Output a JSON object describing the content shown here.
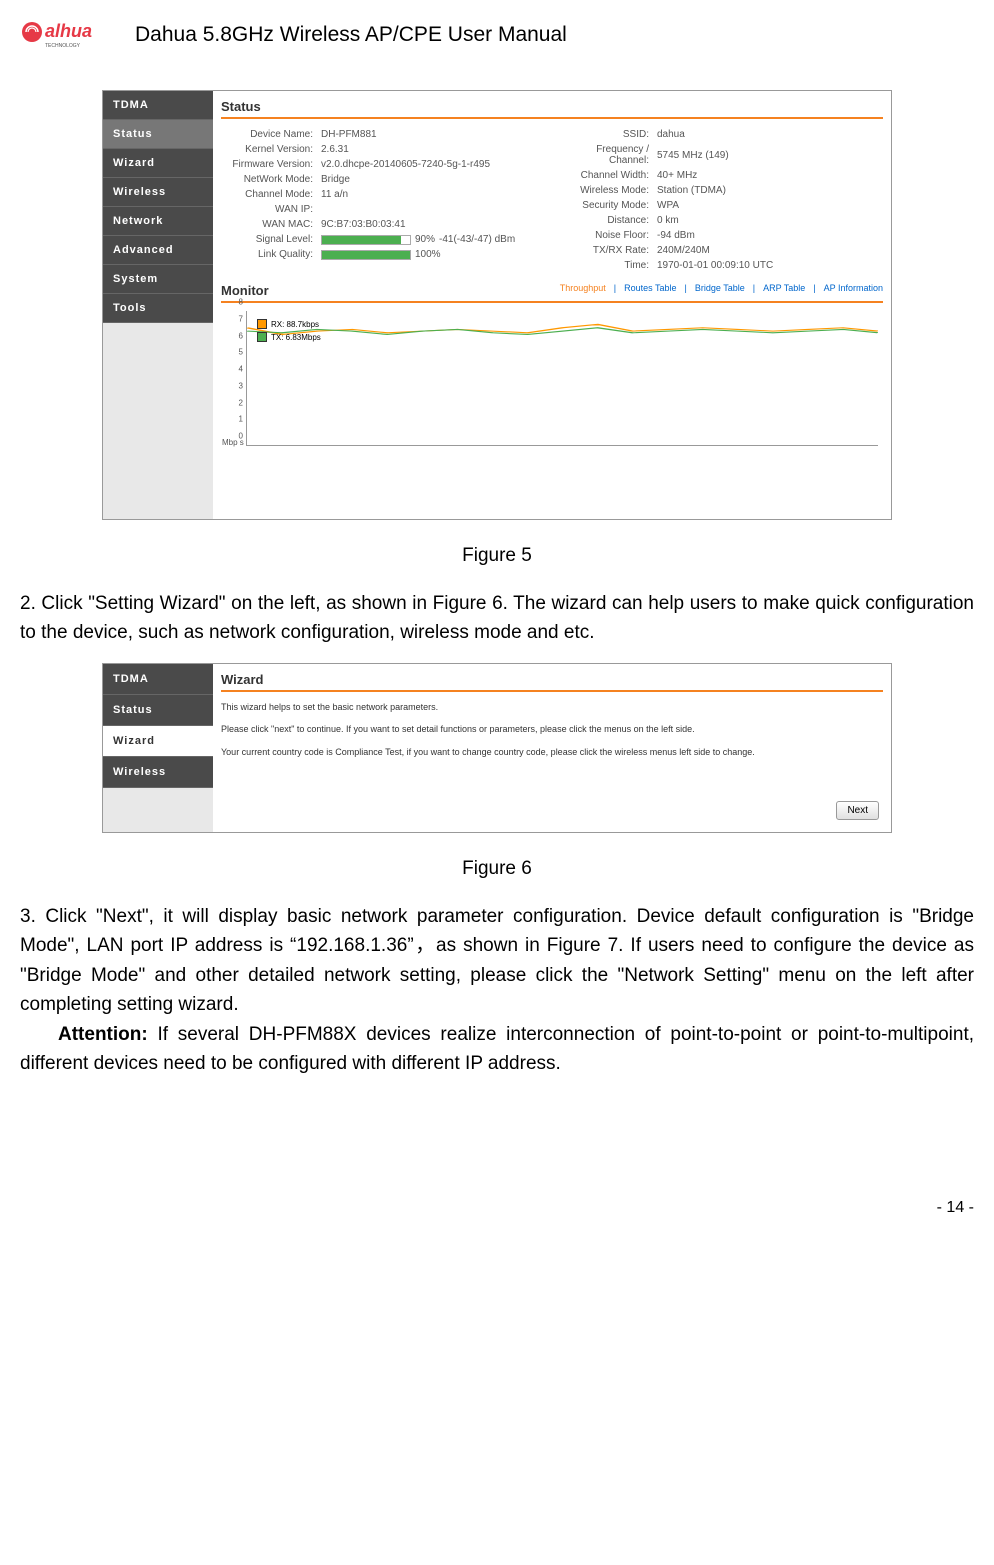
{
  "header": {
    "title": "Dahua 5.8GHz Wireless AP/CPE User Manual"
  },
  "logo": {
    "brand": "alhua",
    "sub": "TECHNOLOGY"
  },
  "fig5": {
    "sidebar": [
      "TDMA",
      "Status",
      "Wizard",
      "Wireless",
      "Network",
      "Advanced",
      "System",
      "Tools"
    ],
    "status_title": "Status",
    "left": [
      {
        "l": "Device Name:",
        "v": "DH-PFM881"
      },
      {
        "l": "Kernel Version:",
        "v": "2.6.31"
      },
      {
        "l": "Firmware Version:",
        "v": "v2.0.dhcpe-20140605-7240-5g-1-r495"
      },
      {
        "l": "NetWork Mode:",
        "v": "Bridge"
      },
      {
        "l": "Channel Mode:",
        "v": "11 a/n"
      },
      {
        "l": "WAN IP:",
        "v": ""
      },
      {
        "l": "WAN MAC:",
        "v": "9C:B7:03:B0:03:41"
      }
    ],
    "signal": {
      "l": "Signal Level:",
      "pct": "90%",
      "extra": "-41(-43/-47) dBm"
    },
    "link": {
      "l": "Link Quality:",
      "pct": "100%"
    },
    "right": [
      {
        "l": "SSID:",
        "v": "dahua"
      },
      {
        "l": "Frequency / Channel:",
        "v": "5745 MHz (149)"
      },
      {
        "l": "Channel Width:",
        "v": "40+ MHz"
      },
      {
        "l": "Wireless Mode:",
        "v": "Station (TDMA)"
      },
      {
        "l": "Security Mode:",
        "v": "WPA"
      },
      {
        "l": "Distance:",
        "v": "0 km"
      },
      {
        "l": "Noise Floor:",
        "v": "-94 dBm"
      },
      {
        "l": "TX/RX Rate:",
        "v": "240M/240M"
      },
      {
        "l": "Time:",
        "v": "1970-01-01 00:09:10 UTC"
      }
    ],
    "monitor_title": "Monitor",
    "monitor_tabs": [
      "Throughput",
      "Routes Table",
      "Bridge Table",
      "ARP Table",
      "AP Information"
    ],
    "legend": [
      {
        "label": "RX: 88.7kbps",
        "color": "#ff9800"
      },
      {
        "label": "TX: 6.83Mbps",
        "color": "#4caf50"
      }
    ],
    "ylabel": "Mbp s",
    "caption": "Figure 5"
  },
  "para2": "2. Click \"Setting Wizard\" on the left, as shown in Figure 6. The wizard can help users to make quick configuration to the device, such as network configuration, wireless mode and etc.",
  "fig6": {
    "sidebar": [
      "TDMA",
      "Status",
      "Wizard",
      "Wireless"
    ],
    "title": "Wizard",
    "line1": "This wizard helps to set the basic network parameters.",
    "line2": "Please click \"next\" to continue. If you want to set detail functions or parameters, please click the menus on the left side.",
    "line3": "Your current country code is Compliance Test, if you want to change country code, please click the wireless menus left side to change.",
    "next": "Next",
    "caption": "Figure 6"
  },
  "para3": "3. Click \"Next\", it will display basic network parameter configuration. Device default configuration is \"Bridge Mode\", LAN port IP address is “192.168.1.36”，as shown in Figure 7. If users need to configure the device as \"Bridge Mode\" and other detailed network setting, please click the \"Network Setting\" menu on the left after completing setting wizard.",
  "attention_label": "Attention:",
  "attention_text": " If several DH-PFM88X devices realize interconnection of point-to-point or point-to-multipoint, different devices need to be configured with different IP address.",
  "page_num": "- 14 -",
  "chart_data": {
    "type": "line",
    "ylim": [
      0,
      8
    ],
    "yticks": [
      0,
      1,
      2,
      3,
      4,
      5,
      6,
      7,
      8
    ],
    "ylabel": "Mbps",
    "series": [
      {
        "name": "RX",
        "color": "#ff9800",
        "values": [
          7.0,
          6.6,
          6.8,
          6.9,
          6.7,
          6.8,
          6.9,
          6.8,
          6.7,
          7.0,
          7.2,
          6.8,
          6.9,
          7.0,
          6.9,
          6.8,
          6.9,
          7.0,
          6.8
        ]
      },
      {
        "name": "TX",
        "color": "#4caf50",
        "values": [
          6.8,
          6.7,
          6.9,
          6.8,
          6.6,
          6.8,
          6.9,
          6.7,
          6.6,
          6.8,
          7.0,
          6.7,
          6.8,
          6.9,
          6.8,
          6.7,
          6.8,
          6.9,
          6.7
        ]
      }
    ]
  }
}
